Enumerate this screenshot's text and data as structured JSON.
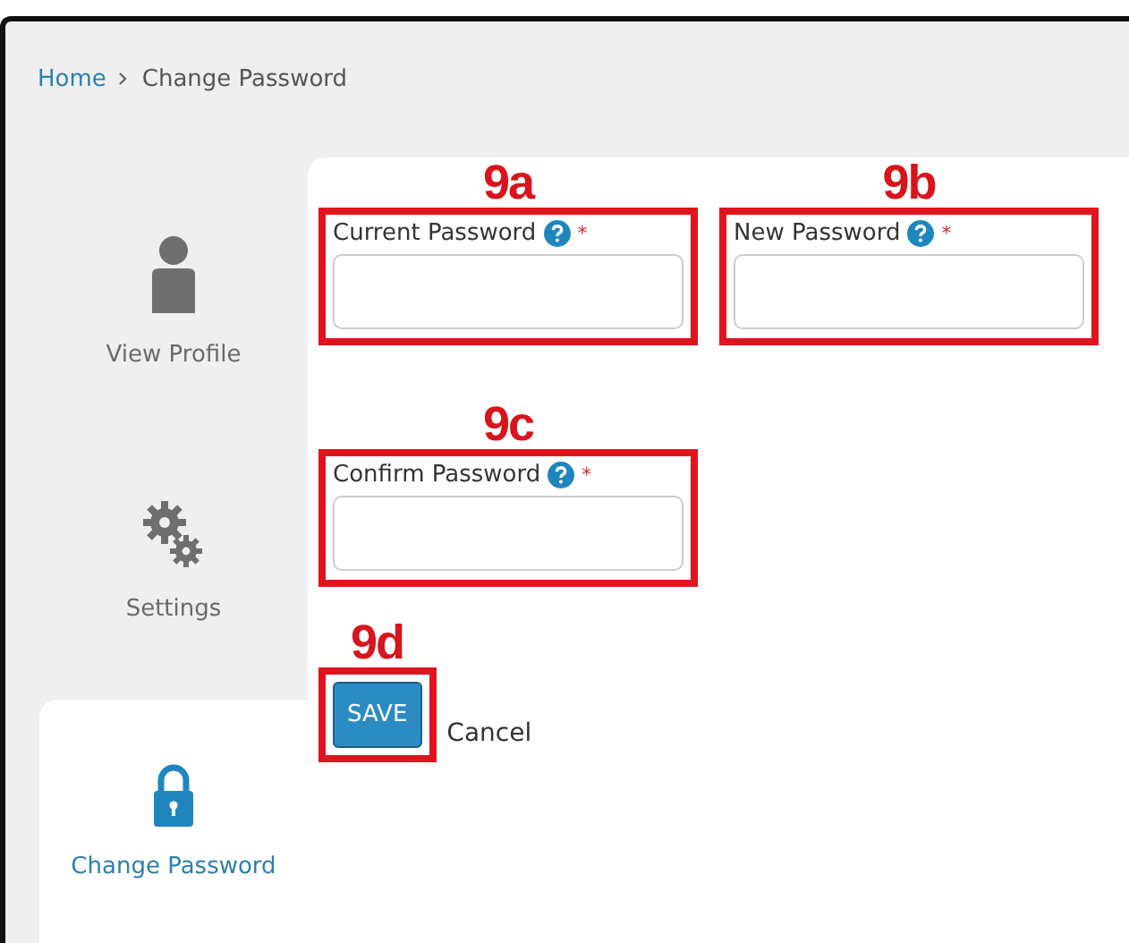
{
  "breadcrumb": {
    "items": [
      {
        "label": "Home",
        "kind": "link"
      },
      {
        "label": "Change Password",
        "kind": "current"
      }
    ]
  },
  "sidebar": {
    "items": [
      {
        "label": "View Profile",
        "kind": "profile",
        "selected": false
      },
      {
        "label": "Settings",
        "kind": "settings",
        "selected": false
      },
      {
        "label": "Change Password",
        "kind": "password",
        "selected": true
      }
    ]
  },
  "form": {
    "fields": [
      {
        "callout": "9a",
        "label": "Current Password",
        "required_mark": "*"
      },
      {
        "callout": "9b",
        "label": "New Password",
        "required_mark": "*"
      },
      {
        "callout": "9c",
        "label": "Confirm Password",
        "required_mark": "*"
      }
    ],
    "actions": {
      "callout": "9d",
      "save": "SAVE",
      "cancel": "Cancel"
    }
  }
}
